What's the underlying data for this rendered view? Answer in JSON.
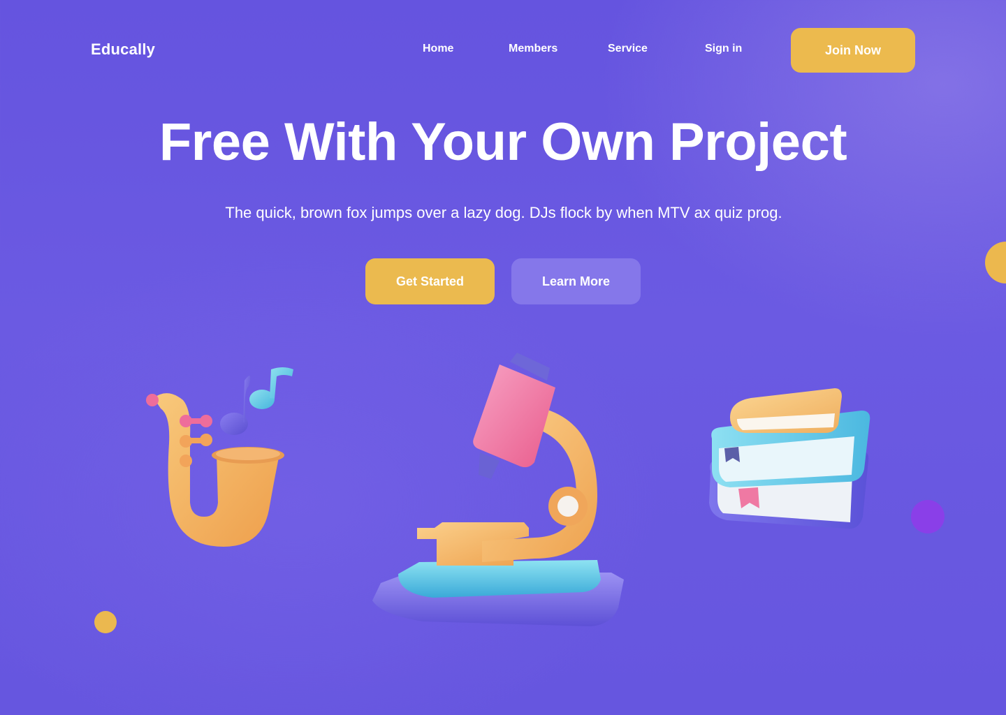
{
  "brand": {
    "name": "Educally"
  },
  "nav": {
    "items": [
      {
        "label": "Home"
      },
      {
        "label": "Members"
      },
      {
        "label": "Service"
      },
      {
        "label": "Sign in"
      }
    ],
    "cta_label": "Join Now"
  },
  "hero": {
    "title": "Free With Your Own Project",
    "subtitle": "The quick, brown fox jumps over a lazy dog. DJs flock by when MTV ax quiz prog.",
    "primary_label": "Get Started",
    "secondary_label": "Learn More"
  },
  "colors": {
    "background": "#6554df",
    "accent_yellow": "#ecba4e",
    "secondary_button": "#8577ea",
    "decor_purple": "#8a3fe8"
  },
  "illustrations": {
    "left": "saxophone-with-music-notes",
    "center": "microscope",
    "right": "stack-of-books"
  }
}
